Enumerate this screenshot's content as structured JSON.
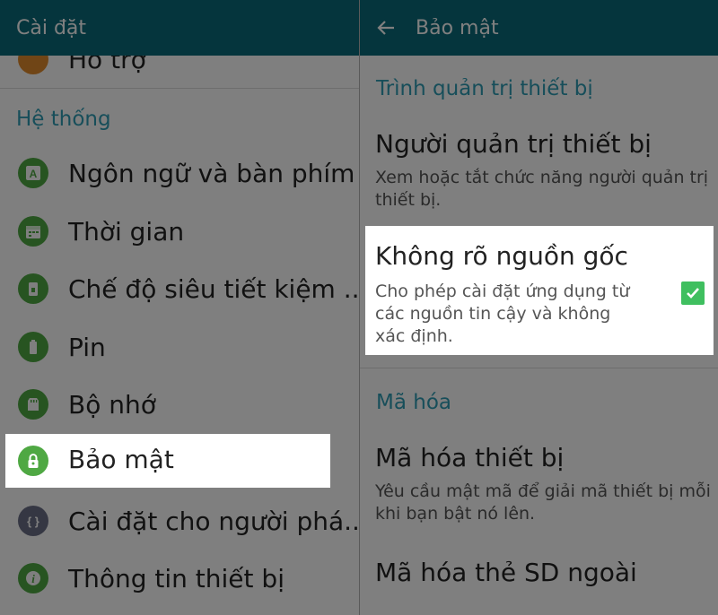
{
  "left": {
    "title": "Cài đặt",
    "partial_item": "Hỗ trợ",
    "section": "Hệ thống",
    "items": [
      {
        "label": "Ngôn ngữ và bàn phím",
        "icon": "keyboard-icon"
      },
      {
        "label": "Thời gian",
        "icon": "calendar-icon"
      },
      {
        "label": "Chế độ siêu tiết kiệm ..",
        "icon": "power-saving-icon"
      },
      {
        "label": "Pin",
        "icon": "battery-icon"
      },
      {
        "label": "Bộ nhớ",
        "icon": "storage-icon"
      },
      {
        "label": "Bảo mật",
        "icon": "lock-icon"
      },
      {
        "label": "Cài đặt cho người phá..",
        "icon": "developer-icon"
      },
      {
        "label": "Thông tin thiết bị",
        "icon": "info-icon"
      }
    ]
  },
  "right": {
    "title": "Bảo mật",
    "section1": "Trình quản trị thiết bị",
    "admin": {
      "title": "Người quản trị thiết bị",
      "subtitle": "Xem hoặc tắt chức năng người quản trị thiết bị."
    },
    "unknown": {
      "title": "Không rõ nguồn gốc",
      "subtitle": "Cho phép cài đặt ứng dụng từ các nguồn tin cậy và không xác định.",
      "checked": true
    },
    "section2": "Mã hóa",
    "encrypt": {
      "title": "Mã hóa thiết bị",
      "subtitle": "Yêu cầu mật mã để giải mã thiết bị mỗi khi bạn bật nó lên."
    },
    "sd": {
      "title": "Mã hóa thẻ SD ngoài"
    }
  },
  "colors": {
    "appbar": "#0b6b7a",
    "accent": "#2f9db4",
    "icon_green": "#4fa843",
    "check_green": "#3fbf5f"
  }
}
